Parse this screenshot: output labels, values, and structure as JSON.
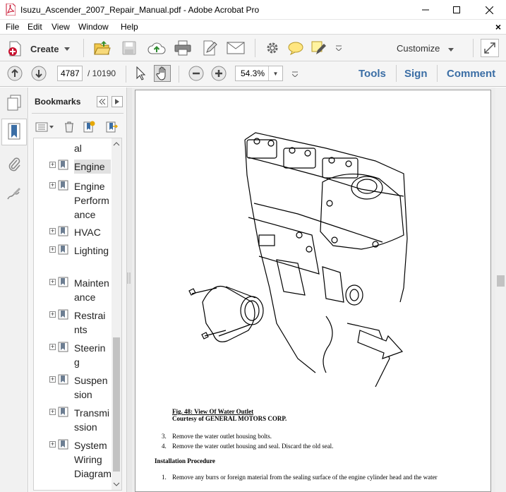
{
  "window": {
    "title": "Isuzu_Ascender_2007_Repair_Manual.pdf - Adobe Acrobat Pro",
    "minimize": "—",
    "maximize": "☐",
    "close": "✕"
  },
  "menu": {
    "items": [
      "File",
      "Edit",
      "View",
      "Window",
      "Help"
    ],
    "close_doc": "×"
  },
  "toolbar": {
    "create_label": "Create",
    "customize_label": "Customize"
  },
  "nav": {
    "current_page": "4787",
    "total_pages": "/ 10190",
    "zoom": "54.3%"
  },
  "tabs": [
    "Tools",
    "Sign",
    "Comment"
  ],
  "bookmarks": {
    "title": "Bookmarks",
    "items": [
      {
        "label": "al",
        "partial": true
      },
      {
        "label": "Engine",
        "selected": true
      },
      {
        "label": "Engine Performance"
      },
      {
        "label": "HVAC"
      },
      {
        "label": "Lighting"
      },
      {
        "label": "Maintenance"
      },
      {
        "label": "Restraints"
      },
      {
        "label": "Steering"
      },
      {
        "label": "Suspension"
      },
      {
        "label": "Transmission"
      },
      {
        "label": "System Wiring Diagrams"
      }
    ]
  },
  "document": {
    "figure_title": "Fig. 48: View Of Water Outlet",
    "figure_credit": "Courtesy of GENERAL MOTORS CORP.",
    "steps": [
      {
        "num": "3.",
        "text": "Remove the water outlet housing bolts."
      },
      {
        "num": "4.",
        "text": "Remove the water outlet housing and seal. Discard the old seal."
      }
    ],
    "section_heading": "Installation Procedure",
    "install_steps": [
      {
        "num": "1.",
        "text": "Remove any burrs or foreign material from the sealing surface of the engine cylinder head and the water"
      }
    ]
  },
  "colors": {
    "tab_blue": "#3b6ea5",
    "acrobat_red": "#c8102e",
    "toolbar_bg": "#f5f5f5"
  }
}
